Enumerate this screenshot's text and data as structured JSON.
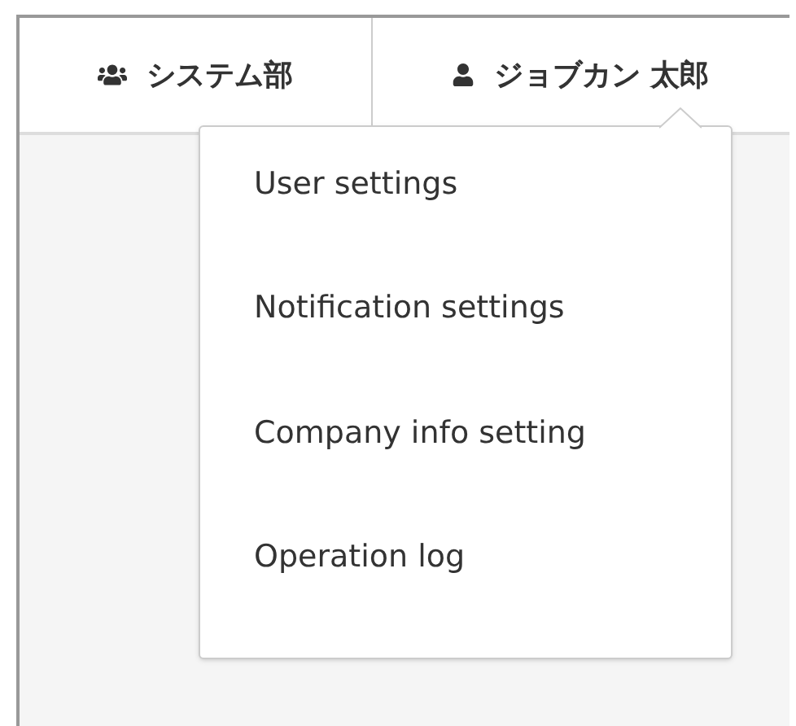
{
  "header": {
    "tabs": [
      {
        "kind": "group",
        "label": "システム部"
      },
      {
        "kind": "user",
        "label": "ジョブカン 太郎"
      }
    ]
  },
  "menu": {
    "items": [
      "User settings",
      "Notification settings",
      "Company info setting",
      "Operation log"
    ]
  }
}
